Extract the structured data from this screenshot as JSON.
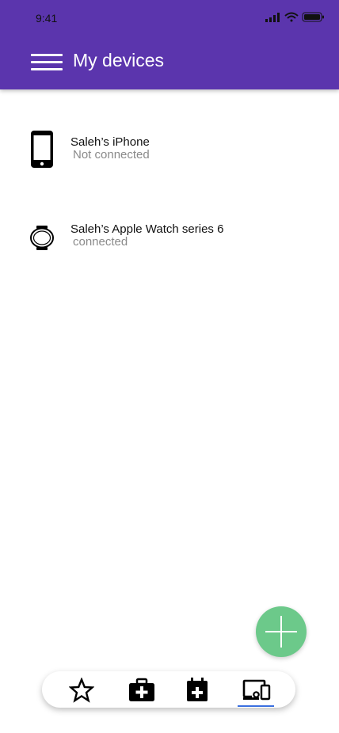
{
  "status_bar": {
    "time": "9:41",
    "icons": [
      "cellular-signal-icon",
      "wifi-icon",
      "battery-icon"
    ]
  },
  "header": {
    "menu_icon": "hamburger-menu-icon",
    "title": "My devices",
    "background_color": "#5b35ad"
  },
  "devices": [
    {
      "icon": "smartphone-icon",
      "name": "Saleh’s iPhone",
      "status": "Not connected"
    },
    {
      "icon": "smartwatch-icon",
      "name": "Saleh’s Apple Watch series 6",
      "status": "connected"
    }
  ],
  "fab": {
    "icon": "plus-icon",
    "color": "#6cc98a"
  },
  "bottom_nav": {
    "items": [
      {
        "icon": "star-icon",
        "active": false
      },
      {
        "icon": "medical-kit-icon",
        "active": false
      },
      {
        "icon": "calendar-plus-icon",
        "active": false
      },
      {
        "icon": "devices-icon",
        "active": true
      }
    ],
    "active_color": "#3b6fe0"
  }
}
